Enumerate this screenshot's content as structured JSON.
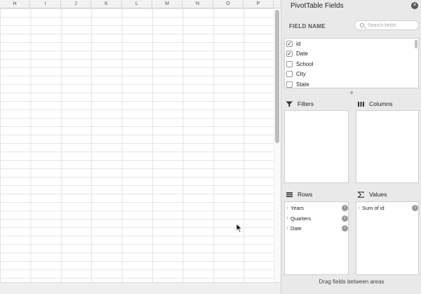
{
  "columns": [
    "H",
    "I",
    "J",
    "K",
    "L",
    "M",
    "N",
    "O",
    "P"
  ],
  "panel": {
    "title": "PivotTable Fields",
    "close_glyph": "✕",
    "field_name_label": "FIELD NAME",
    "search_placeholder": "Search fields",
    "fields": [
      {
        "label": "id",
        "checked": true
      },
      {
        "label": "Date",
        "checked": true
      },
      {
        "label": "School",
        "checked": false
      },
      {
        "label": "City",
        "checked": false
      },
      {
        "label": "State",
        "checked": false
      }
    ],
    "filters_label": "Filters",
    "columns_label": "Columns",
    "rows_label": "Rows",
    "values_label": "Values",
    "rows_items": [
      "Years",
      "Quarters",
      "Date"
    ],
    "values_items": [
      "Sum of id"
    ],
    "footer": "Drag fields between areas"
  }
}
